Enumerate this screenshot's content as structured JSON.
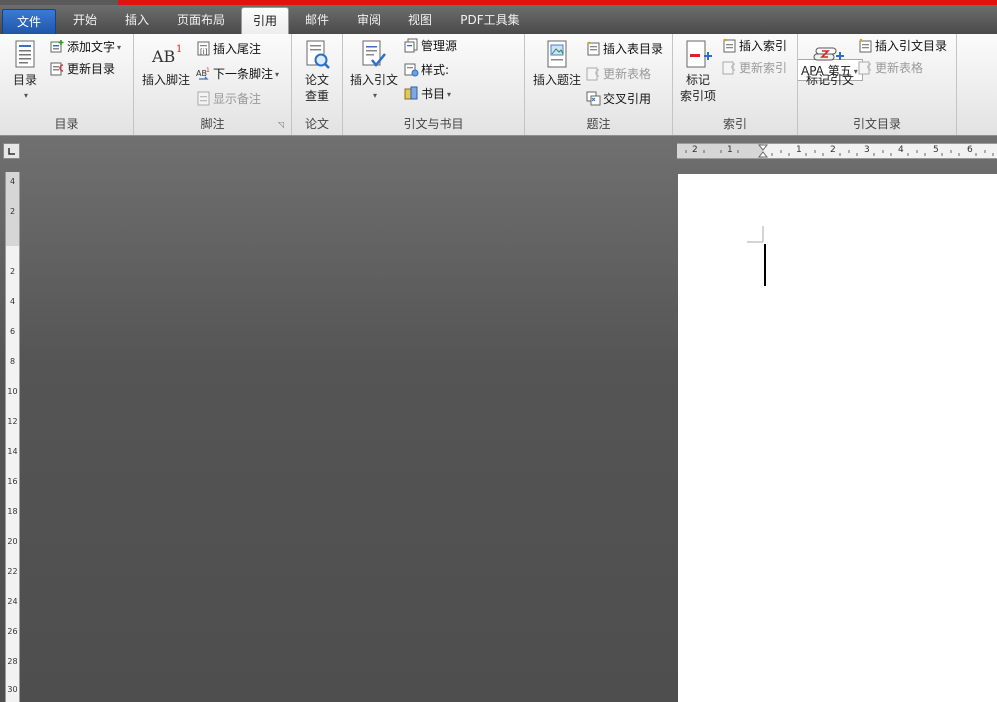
{
  "tabs": {
    "file": "文件",
    "home": "开始",
    "insert": "插入",
    "layout": "页面布局",
    "references": "引用",
    "mailings": "邮件",
    "review": "审阅",
    "view": "视图",
    "pdf": "PDF工具集"
  },
  "groups": {
    "toc": {
      "label": "目录",
      "toc_button": "目录",
      "add_text": "添加文字",
      "update_toc": "更新目录"
    },
    "footnotes": {
      "label": "脚注",
      "insert_footnote": "插入脚注",
      "insert_endnote": "插入尾注",
      "next_footnote": "下一条脚注",
      "show_notes": "显示备注"
    },
    "paper": {
      "label": "论文",
      "check_line1": "论文",
      "check_line2": "查重"
    },
    "citations": {
      "label": "引文与书目",
      "insert_citation": "插入引文",
      "manage_sources": "管理源",
      "style_label": "样式:",
      "style_value": "APA 第五",
      "bibliography": "书目"
    },
    "captions": {
      "label": "题注",
      "insert_caption": "插入题注",
      "insert_table_of_figures": "插入表目录",
      "update_table": "更新表格",
      "cross_reference": "交叉引用"
    },
    "index": {
      "label": "索引",
      "mark_entry_line1": "标记",
      "mark_entry_line2": "索引项",
      "insert_index": "插入索引",
      "update_index": "更新索引"
    },
    "toa": {
      "label": "引文目录",
      "mark_citation": "标记引文",
      "insert_toa": "插入引文目录",
      "update_table": "更新表格"
    }
  },
  "rulers": {
    "horizontal_ticks": [
      "2",
      "1",
      "1",
      "2",
      "3",
      "4",
      "5",
      "6"
    ],
    "vertical_ticks": [
      "4",
      "2",
      "2",
      "4",
      "6",
      "8",
      "10",
      "12",
      "14",
      "16",
      "18",
      "20",
      "22",
      "24",
      "26",
      "28",
      "30"
    ]
  },
  "colors": {
    "accent_red": "#e0140f",
    "file_tab": "#2a66c0"
  }
}
